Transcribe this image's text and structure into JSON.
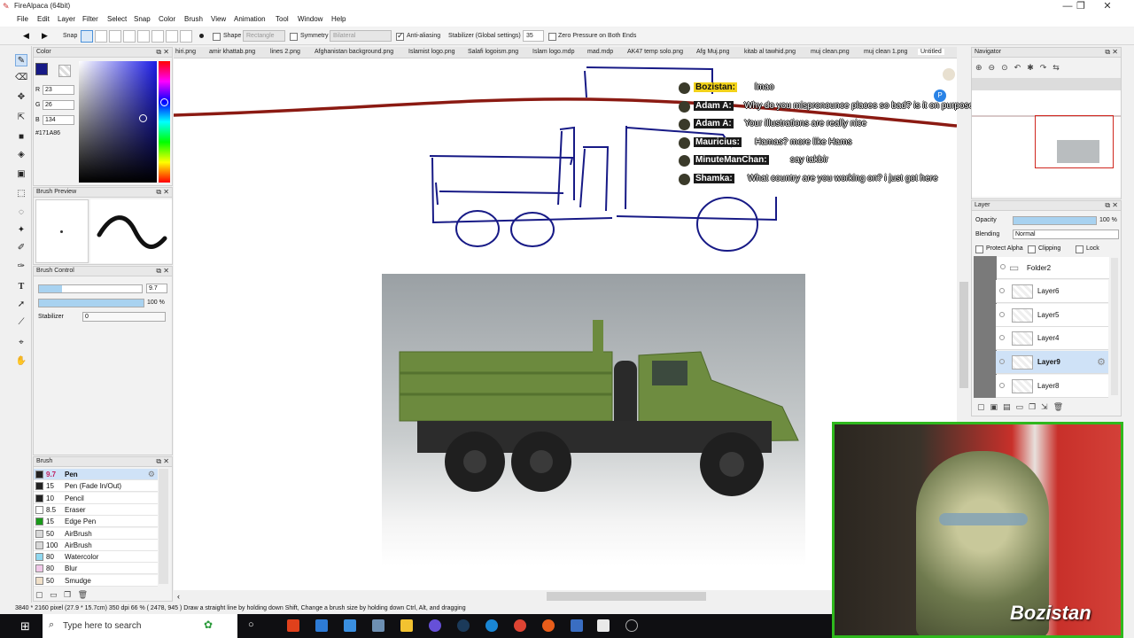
{
  "app": {
    "title": "FireAlpaca (64bit)",
    "window_buttons": [
      "—",
      "❐",
      "✕"
    ]
  },
  "menu": [
    "File",
    "Edit",
    "Layer",
    "Filter",
    "Select",
    "Snap",
    "Color",
    "Brush",
    "View",
    "Animation",
    "Tool",
    "Window",
    "Help"
  ],
  "toolbar": {
    "snap_label": "Snap",
    "shape_label": "Shape",
    "shape_value": "Rectangle",
    "symmetry_label": "Symmetry",
    "symmetry_value": "Bilateral",
    "antialiasing_label": "Anti-aliasing",
    "stabilizer_label": "Stabilizer (Global settings)",
    "stabilizer_value": "35",
    "zero_pressure_label": "Zero Pressure on Both Ends"
  },
  "color_panel": {
    "title": "Color",
    "r_label": "R",
    "r": "23",
    "g_label": "G",
    "g": "26",
    "b_label": "B",
    "b": "134",
    "hex": "#171A86",
    "current_color": "#171A86"
  },
  "brush_preview": {
    "title": "Brush Preview"
  },
  "brush_control": {
    "title": "Brush Control",
    "size": "9.7",
    "opacity": "100 %",
    "stabilizer_label": "Stabilizer",
    "stabilizer_value": "0"
  },
  "brush_panel": {
    "title": "Brush",
    "items": [
      {
        "size": "9.7",
        "name": "Pen",
        "color": "#222222"
      },
      {
        "size": "15",
        "name": "Pen (Fade In/Out)",
        "color": "#222222"
      },
      {
        "size": "10",
        "name": "Pencil",
        "color": "#222222"
      },
      {
        "size": "8.5",
        "name": "Eraser",
        "color": "#ffffff"
      },
      {
        "size": "15",
        "name": "Edge Pen",
        "color": "#1a9a1a"
      },
      {
        "size": "50",
        "name": "AirBrush",
        "color": "#d8d8d8"
      },
      {
        "size": "100",
        "name": "AirBrush",
        "color": "#d8d8d8"
      },
      {
        "size": "80",
        "name": "Watercolor",
        "color": "#8fd8f0"
      },
      {
        "size": "80",
        "name": "Blur",
        "color": "#f0c8e8"
      },
      {
        "size": "50",
        "name": "Smudge",
        "color": "#f0e0c8"
      }
    ]
  },
  "tabs": [
    "hiri.png",
    "amir khattab.png",
    "lines 2.png",
    "Afghanistan background.png",
    "Islamist logo.png",
    "Salafi logoism.png",
    "Islam logo.mdp",
    "mad.mdp",
    "AK47 temp solo.png",
    "Afg Muj.png",
    "kitab al tawhid.png",
    "muj clean.png",
    "muj clean 1.png",
    "Untitled"
  ],
  "chat": [
    {
      "name": "Bozistan:",
      "message": "lmao",
      "highlight": true
    },
    {
      "name": "Adam A:",
      "message": "Why do you mispronounce places so bad? is it on purpose?"
    },
    {
      "name": "Adam A:",
      "message": "Your illustrations are really nice"
    },
    {
      "name": "Mauricius:",
      "message": "Hamas? more like Hams"
    },
    {
      "name": "MinuteManChan:",
      "message": "say takbir"
    },
    {
      "name": "Shamka:",
      "message": "What country are you working on? i just got here"
    }
  ],
  "navigator": {
    "title": "Navigator"
  },
  "layer_panel": {
    "title": "Layer",
    "opacity_label": "Opacity",
    "opacity_value": "100 %",
    "blending_label": "Blending",
    "blending_value": "Normal",
    "protect_alpha": "Protect Alpha",
    "clipping": "Clipping",
    "lock": "Lock",
    "folder": "Folder2",
    "layers": [
      "Layer6",
      "Layer5",
      "Layer4",
      "Layer9",
      "Layer8"
    ],
    "selected": "Layer9"
  },
  "status": {
    "text": "3840 * 2160 pixel  (27.9 * 15.7cm)  350 dpi  66 %  ( 2478, 945 )  Draw a straight line by holding down Shift, Change a brush size by holding down Ctrl, Alt, and dragging"
  },
  "taskbar": {
    "search_placeholder": "Type here to search"
  },
  "webcam": {
    "watermark": "Bozistan"
  }
}
